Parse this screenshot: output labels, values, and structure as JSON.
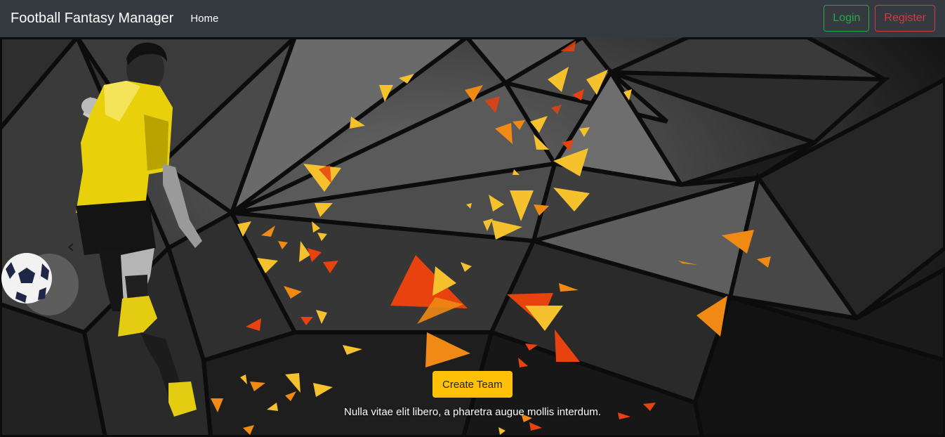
{
  "navbar": {
    "brand": "Football Fantasy Manager",
    "links": [
      {
        "label": "Home"
      }
    ],
    "login_label": "Login",
    "register_label": "Register"
  },
  "hero": {
    "cta_label": "Create Team",
    "caption": "Nulla vitae elit libero, a pharetra augue mollis interdum.",
    "prev_icon": "chevron-left-icon"
  },
  "colors": {
    "navbar_bg": "#343a40",
    "login": "#28a745",
    "register": "#dc3545",
    "cta": "#ffc107",
    "accent_yellow": "#f5c22e",
    "accent_orange": "#f08a14",
    "accent_red": "#e8420f"
  }
}
